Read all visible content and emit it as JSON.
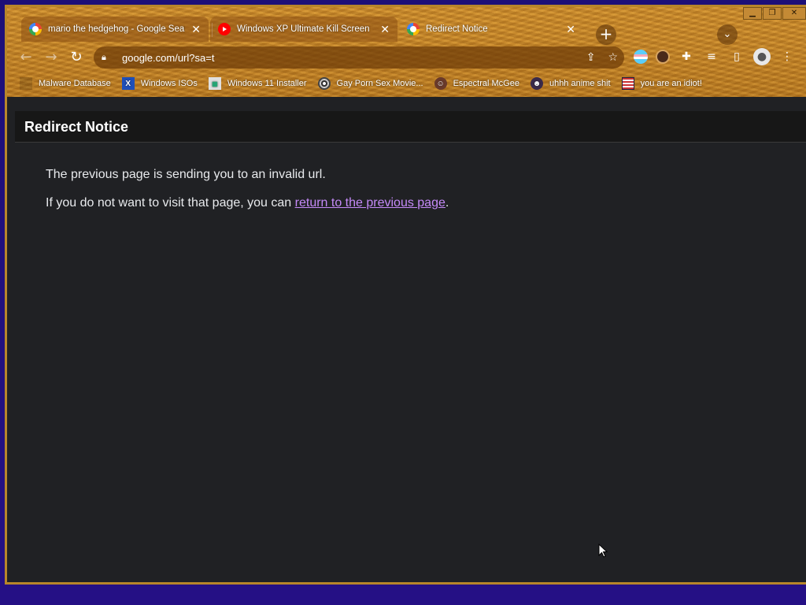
{
  "tabs": [
    {
      "title": "mario the hedgehog - Google Search",
      "icon": "google-icon",
      "close": "✕"
    },
    {
      "title": "Windows XP Ultimate Kill Screen",
      "icon": "youtube-icon",
      "close": "✕"
    },
    {
      "title": "Redirect Notice",
      "icon": "google-icon",
      "close": "✕"
    }
  ],
  "toolbar": {
    "url": "google.com/url?sa=t"
  },
  "bookmarks": [
    {
      "label": "Malware Database",
      "icon": "blank-icon"
    },
    {
      "label": "Windows ISOs",
      "icon": "x-icon"
    },
    {
      "label": "Windows 11 Installer",
      "icon": "windows-icon"
    },
    {
      "label": "Gay Porn Sex Movie...",
      "icon": "disc-icon"
    },
    {
      "label": "Espectral McGee",
      "icon": "character-icon"
    },
    {
      "label": "uhhh anime shit",
      "icon": "anime-icon"
    },
    {
      "label": "you are an idiot!",
      "icon": "flag-icon"
    }
  ],
  "page": {
    "title": "Redirect Notice",
    "line1": "The previous page is sending you to an invalid url.",
    "line2_prefix": "If you do not want to visit that page, you can ",
    "link_text": "return to the previous page",
    "line2_suffix": "."
  },
  "colors": {
    "link": "#c58af9",
    "page_bg": "#202124",
    "header_bg": "#171717"
  }
}
